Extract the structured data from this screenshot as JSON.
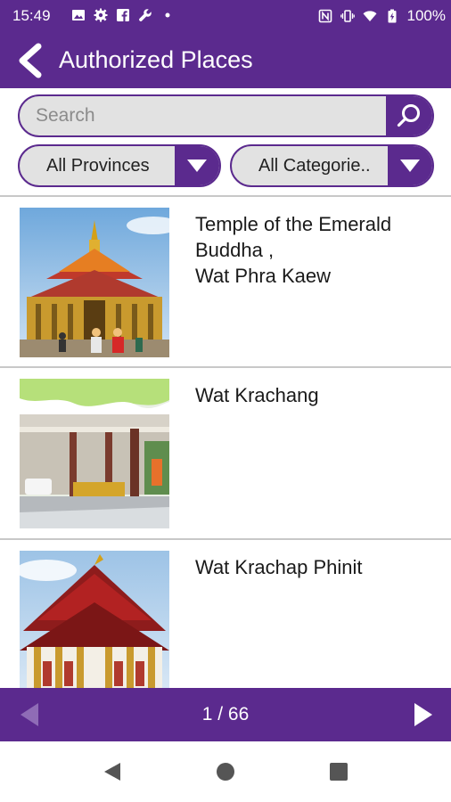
{
  "status_bar": {
    "time": "15:49",
    "battery": "100%",
    "left_icons": [
      "image-icon",
      "gear-icon",
      "facebook-icon",
      "wrench-icon",
      "dot-icon"
    ],
    "right_icons": [
      "nfc-icon",
      "vibrate-icon",
      "wifi-icon",
      "battery-icon"
    ]
  },
  "app_bar": {
    "title": "Authorized Places",
    "back_icon": "chevron-left-icon"
  },
  "search": {
    "placeholder": "Search",
    "value": "",
    "button_icon": "search-icon"
  },
  "filters": {
    "province": "All Provinces",
    "category": "All Categorie.."
  },
  "places": [
    {
      "name": "Temple of the Emerald\nBuddha ,\nWat Phra Kaew"
    },
    {
      "name": "Wat Krachang"
    },
    {
      "name": "Wat Krachap Phinit"
    }
  ],
  "pager": {
    "indicator": "1 / 66",
    "current_page": 1,
    "total_pages": 66
  },
  "nav_bar": {
    "buttons": [
      "back-triangle-icon",
      "home-circle-icon",
      "recents-square-icon"
    ]
  },
  "colors": {
    "primary": "#5b2a8e",
    "field_bg": "#e2e2e2",
    "divider": "#c8c8c8",
    "prev_disabled": "#8f6cb6"
  }
}
